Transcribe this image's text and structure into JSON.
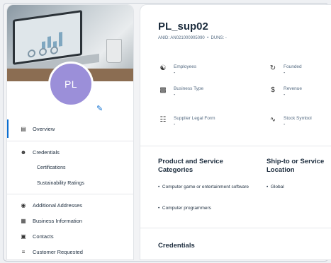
{
  "profile": {
    "initials": "PL"
  },
  "sidebar": {
    "items": [
      {
        "label": "Overview",
        "icon": "clipboard-icon"
      },
      {
        "label": "Credentials",
        "icon": "person-key-icon"
      },
      {
        "label": "Certifications"
      },
      {
        "label": "Sustainability Ratings"
      },
      {
        "label": "Additional Addresses",
        "icon": "address-icon"
      },
      {
        "label": "Business Information",
        "icon": "doc-icon"
      },
      {
        "label": "Contacts",
        "icon": "contact-card-icon"
      },
      {
        "label": "Customer Requested",
        "icon": "list-icon"
      }
    ]
  },
  "header": {
    "name": "PL_sup02",
    "anid_label": "ANID:",
    "anid_value": "AN021000905090",
    "duns_label": "DUNS:",
    "duns_value": "-"
  },
  "fields": {
    "employees": {
      "label": "Employees",
      "value": "-"
    },
    "founded": {
      "label": "Founded",
      "value": "-"
    },
    "business_type": {
      "label": "Business Type",
      "value": "-"
    },
    "revenue": {
      "label": "Revenue",
      "value": "-"
    },
    "legal_form": {
      "label": "Supplier Legal Form",
      "value": "-"
    },
    "stock_symbol": {
      "label": "Stock Symbol",
      "value": "-"
    }
  },
  "sections": {
    "products_title": "Product and Service Categories",
    "products": [
      "Computer game or entertainment software",
      "Computer programmers"
    ],
    "ship_title": "Ship-to or Service Location",
    "ship": [
      "Global"
    ],
    "credentials_title": "Credentials"
  }
}
